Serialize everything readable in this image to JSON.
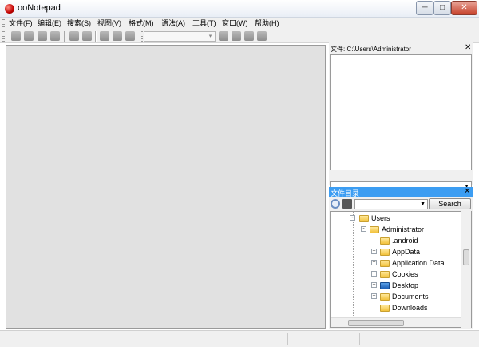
{
  "window": {
    "title": "ooNotepad",
    "min_glyph": "─",
    "max_glyph": "□",
    "close_glyph": "✕"
  },
  "menu": [
    "文件(F)",
    "编辑(E)",
    "搜索(S)",
    "视图(V)",
    "格式(M)",
    "语法(A)",
    "工具(T)",
    "窗口(W)",
    "帮助(H)"
  ],
  "file_panel": {
    "path_label": "文件: C:\\Users\\Administrator",
    "close_glyph": "✕",
    "dropdown_value": ""
  },
  "dir_panel": {
    "title": "文件目录",
    "close_glyph": "✕",
    "search_label": "Search",
    "tree": [
      {
        "label": "Users",
        "icon": "folder",
        "expander": "-"
      },
      {
        "label": "Administrator",
        "icon": "user-folder",
        "expander": "-"
      },
      {
        "label": ".android",
        "icon": "folder",
        "expander": ""
      },
      {
        "label": "AppData",
        "icon": "folder",
        "expander": "+"
      },
      {
        "label": "Application Data",
        "icon": "folder",
        "expander": "+"
      },
      {
        "label": "Cookies",
        "icon": "folder",
        "expander": "+"
      },
      {
        "label": "Desktop",
        "icon": "desktop",
        "expander": "+"
      },
      {
        "label": "Documents",
        "icon": "folder",
        "expander": "+"
      },
      {
        "label": "Downloads",
        "icon": "folder",
        "expander": ""
      }
    ]
  },
  "colors": {
    "dir_header": "#3c9df2",
    "editor_bg": "#e1e1e1"
  }
}
